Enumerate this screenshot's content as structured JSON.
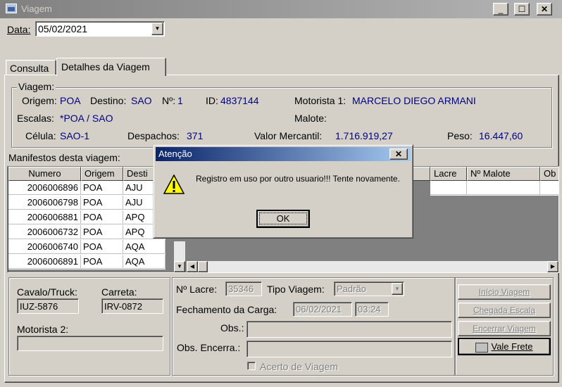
{
  "window": {
    "title": "Viagem",
    "min": "_",
    "max": "☐",
    "close": "✕"
  },
  "date_field": {
    "label": "Data:",
    "value": "05/02/2021"
  },
  "tabs": [
    {
      "label": "Consulta"
    },
    {
      "label": "Detalhes da Viagem"
    }
  ],
  "trip": {
    "group_label": "Viagem:",
    "origem_label": "Origem:",
    "origem": "POA",
    "destino_label": "Destino:",
    "destino": "SAO",
    "numero_label": "Nº:",
    "numero": "1",
    "id_label": "ID:",
    "id": "4837144",
    "motorista1_label": "Motorista 1:",
    "motorista1": "MARCELO DIEGO ARMANI",
    "escalas_label": "Escalas:",
    "escalas": "*POA / SAO",
    "malote_label": "Malote:",
    "celula_label": "Célula:",
    "celula": "SAO-1",
    "despachos_label": "Despachos:",
    "despachos": "371",
    "valor_label": "Valor Mercantil:",
    "valor": "1.716.919,27",
    "peso_label": "Peso:",
    "peso": "16.447,60"
  },
  "manifests": {
    "label": "Manifestos desta viagem:",
    "headers": {
      "numero": "Numero",
      "origem": "Origem",
      "destino": "Desti",
      "lacre": "Lacre",
      "malote": "Nº Malote",
      "obs": "Ob"
    },
    "rows": [
      {
        "numero": "2006006896",
        "origem": "POA",
        "destino": "AJU"
      },
      {
        "numero": "2006006798",
        "origem": "POA",
        "destino": "AJU"
      },
      {
        "numero": "2006006881",
        "origem": "POA",
        "destino": "APQ"
      },
      {
        "numero": "2006006732",
        "origem": "POA",
        "destino": "APQ"
      },
      {
        "numero": "2006006740",
        "origem": "POA",
        "destino": "AQA"
      },
      {
        "numero": "2006006891",
        "origem": "POA",
        "destino": "AQA"
      }
    ]
  },
  "vehicle": {
    "cavalo_label": "Cavalo/Truck:",
    "cavalo": "IUZ-5876",
    "carreta_label": "Carreta:",
    "carreta": "IRV-0872",
    "motorista2_label": "Motorista 2:",
    "motorista2": ""
  },
  "closing": {
    "lacre_label": "Nº Lacre:",
    "lacre": "35346",
    "tipo_label": "Tipo Viagem:",
    "tipo": "Padrão",
    "fechamento_label": "Fechamento da Carga:",
    "fech_date": "06/02/2021",
    "fech_time": "03:24",
    "obs_label": "Obs.:",
    "obs": "",
    "obs_encerra_label": "Obs. Encerra.:",
    "obs_encerra": "",
    "acerto_label": "Acerto de Viagem"
  },
  "buttons": {
    "inicio": "Início Viagem",
    "chegada": "Chegada Escala",
    "encerrar": "Encerrar Viagem",
    "vale_frete": "Vale Frete"
  },
  "dialog": {
    "title": "Atenção",
    "message": "Registro em uso por outro usuario!!! Tente novamente.",
    "ok": "OK"
  }
}
